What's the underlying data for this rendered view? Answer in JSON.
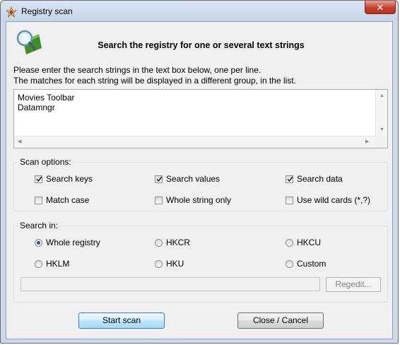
{
  "window": {
    "title": "Registry scan"
  },
  "header": {
    "heading": "Search the registry for one or several text strings",
    "instruction_line1": "Please enter the search strings in the text box below, one per line.",
    "instruction_line2": "The matches for each string will be displayed in a different group, in the list."
  },
  "search_strings": {
    "value": "Movies Toolbar\nDatamngr"
  },
  "scan_options": {
    "label": "Scan options:",
    "search_keys": {
      "label": "Search keys",
      "checked": true
    },
    "search_values": {
      "label": "Search values",
      "checked": true
    },
    "search_data": {
      "label": "Search data",
      "checked": true
    },
    "match_case": {
      "label": "Match case",
      "checked": false
    },
    "whole_string_only": {
      "label": "Whole string only",
      "checked": false
    },
    "use_wild_cards": {
      "label": "Use wild cards (*,?)",
      "checked": false
    }
  },
  "search_in": {
    "label": "Search in:",
    "selected": "whole_registry",
    "options": {
      "whole_registry": "Whole registry",
      "hkcr": "HKCR",
      "hkcu": "HKCU",
      "hklm": "HKLM",
      "hku": "HKU",
      "custom": "Custom"
    },
    "custom_path": "",
    "regedit_label": "Regedit..."
  },
  "buttons": {
    "start_scan": "Start scan",
    "close_cancel": "Close / Cancel"
  },
  "colors": {
    "title_bar": "#cbd9ea",
    "close_button": "#c6402e",
    "dialog_bg": "#f0f0f0",
    "default_button": "#bee6fd"
  }
}
